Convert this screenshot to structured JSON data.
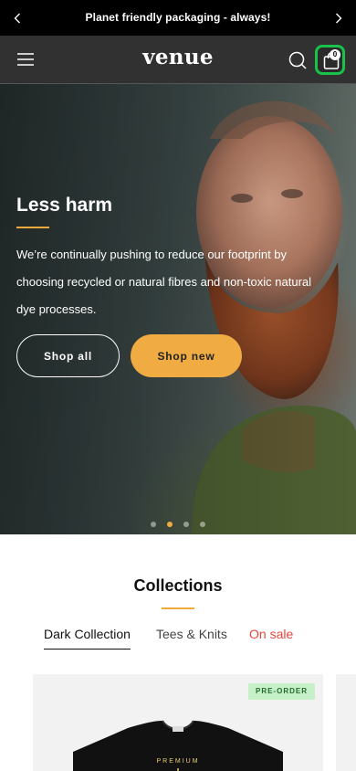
{
  "announcement": {
    "message": "Planet friendly packaging - always!",
    "prev_icon": "chevron-left-icon",
    "next_icon": "chevron-right-icon"
  },
  "header": {
    "logo": "venue",
    "menu_icon": "hamburger-menu-icon",
    "search_icon": "search-icon",
    "cart_icon": "shopping-bag-icon",
    "cart_count": "0",
    "cart_highlight_color": "#19c24a"
  },
  "hero": {
    "title": "Less harm",
    "description": "We’re continually pushing to reduce our footprint by choosing recycled or natural fibres and non-toxic natural dye processes.",
    "primary_button": "Shop all",
    "secondary_button": "Shop new",
    "accent_color": "#f0ac42",
    "slides": 4,
    "active_slide": 2
  },
  "collections": {
    "title": "Collections",
    "tabs": [
      {
        "label": "Dark Collection",
        "active": true
      },
      {
        "label": "Tees & Knits",
        "active": false
      },
      {
        "label": "On sale",
        "active": false,
        "color": "#e5473c"
      }
    ],
    "products": [
      {
        "badge": "PRE-ORDER",
        "print_text": "PREMIUM"
      }
    ]
  }
}
